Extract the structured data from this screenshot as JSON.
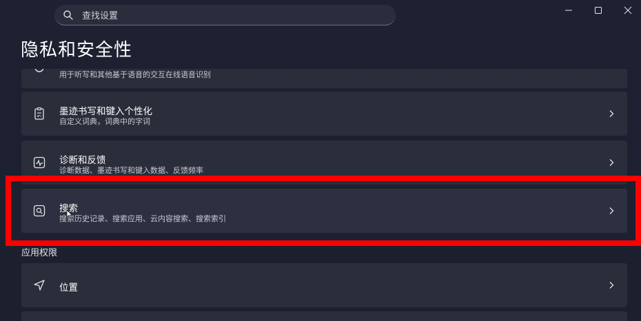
{
  "search": {
    "placeholder": "查找设置"
  },
  "page": {
    "title": "隐私和安全性"
  },
  "items": [
    {
      "id": "speech",
      "title": "",
      "description": "用于听写和其他基于语音的交互在线语音识别",
      "icon": "speech-icon"
    },
    {
      "id": "inking",
      "title": "墨迹书写和键入个性化",
      "description": "自定义词典，词典中的字词",
      "icon": "clipboard-icon"
    },
    {
      "id": "diagnostics",
      "title": "诊断和反馈",
      "description": "诊断数据、墨迹书写和键入数据、反馈频率",
      "icon": "pulse-icon"
    },
    {
      "id": "search",
      "title": "搜索",
      "description": "搜索历史记录、搜索应用、云内容搜索、搜索索引",
      "icon": "search-icon"
    }
  ],
  "app_permissions": {
    "label": "应用权限",
    "items": [
      {
        "id": "location",
        "title": "位置",
        "icon": "location-arrow-icon"
      }
    ]
  },
  "colors": {
    "background": "#1c2030",
    "card": "#2a2d3a",
    "highlight": "#ff0000"
  }
}
